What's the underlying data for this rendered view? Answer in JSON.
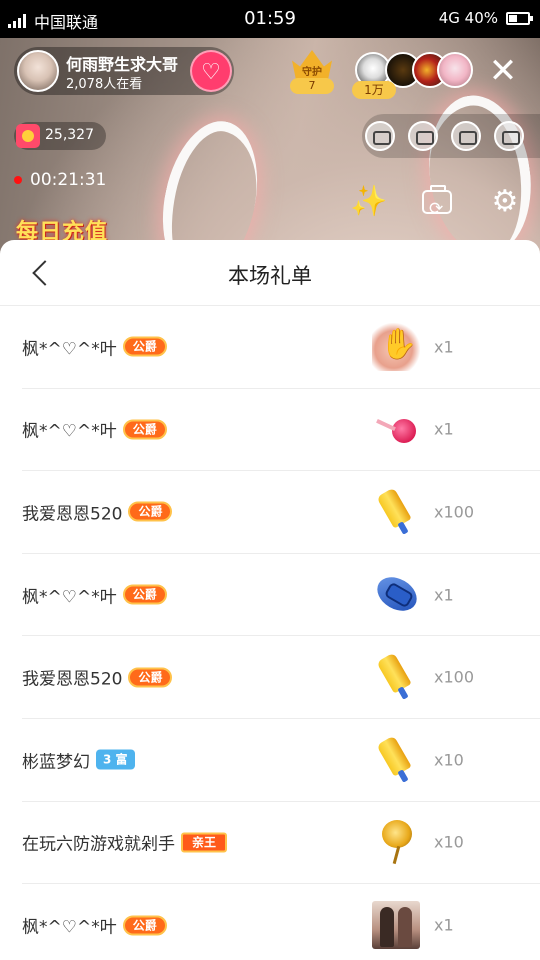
{
  "status_bar": {
    "network": "4G",
    "carrier": "中国联通",
    "time": "01:59",
    "battery": "4G 40%"
  },
  "live": {
    "host_name": "何雨野生求大哥",
    "viewer_count": "2,078人在看",
    "guard_label": "守护",
    "guard_count": "7",
    "top_fans_tag": "1万",
    "coins": "25,327",
    "elapsed": "00:21:31",
    "banner_text": "每日充值"
  },
  "sheet": {
    "title": "本场礼单"
  },
  "gift_list": [
    {
      "sender": "枫*^♡^*叶",
      "badge": "公爵",
      "badge_type": "duke",
      "gift_icon": "hands-icon",
      "qty": "x1"
    },
    {
      "sender": "枫*^♡^*叶",
      "badge": "公爵",
      "badge_type": "duke",
      "gift_icon": "lollipop-icon",
      "qty": "x1"
    },
    {
      "sender": "我爱恩恩520",
      "badge": "公爵",
      "badge_type": "duke",
      "gift_icon": "popsicle-icon",
      "qty": "x100"
    },
    {
      "sender": "枫*^♡^*叶",
      "badge": "公爵",
      "badge_type": "duke",
      "gift_icon": "slipper-icon",
      "qty": "x1"
    },
    {
      "sender": "我爱恩恩520",
      "badge": "公爵",
      "badge_type": "duke",
      "gift_icon": "popsicle-icon",
      "qty": "x100"
    },
    {
      "sender": "彬蓝梦幻",
      "badge": "3 富",
      "badge_type": "rich",
      "gift_icon": "popsicle-icon",
      "qty": "x10"
    },
    {
      "sender": "在玩六防游戏就剁手",
      "badge": "亲王",
      "badge_type": "prince",
      "gift_icon": "golden-rose-icon",
      "qty": "x10"
    },
    {
      "sender": "枫*^♡^*叶",
      "badge": "公爵",
      "badge_type": "duke",
      "gift_icon": "couple-photo-icon",
      "qty": "x1"
    }
  ],
  "colors": {
    "follow_button": "#ff3d6e",
    "duke_badge": "#ff6a1a",
    "rich_badge": "#4eb3ee",
    "quantity_text": "#999999"
  }
}
